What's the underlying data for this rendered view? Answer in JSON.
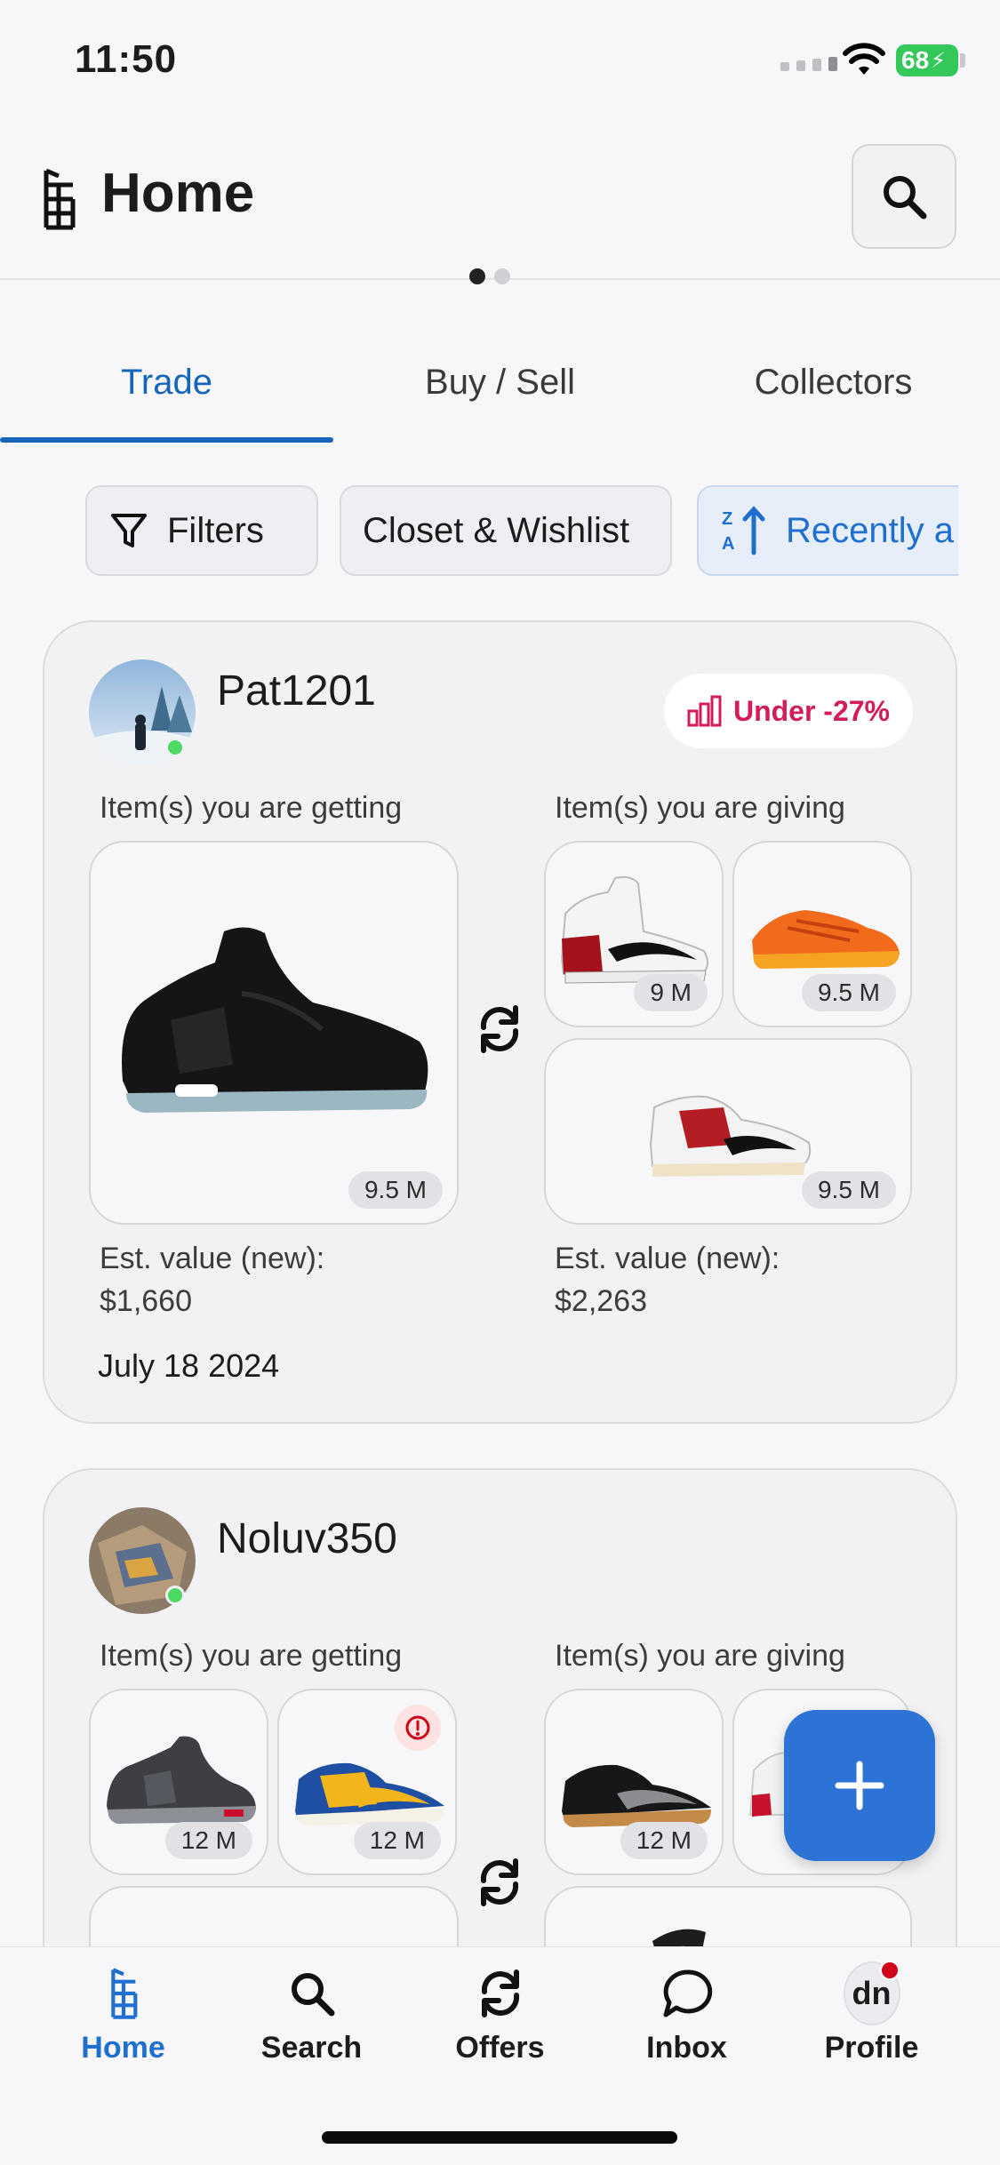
{
  "status_bar": {
    "time": "11:50",
    "battery": "68"
  },
  "header": {
    "title": "Home"
  },
  "tabs": [
    {
      "label": "Trade",
      "active": true
    },
    {
      "label": "Buy / Sell",
      "active": false
    },
    {
      "label": "Collectors",
      "active": false
    }
  ],
  "filters": {
    "filters_label": "Filters",
    "closet_label": "Closet & Wishlist",
    "sort_label": "Recently a"
  },
  "trades": [
    {
      "username": "Pat1201",
      "badge": "Under -27%",
      "getting_label": "Item(s) you are getting",
      "giving_label": "Item(s) you are giving",
      "getting_items": [
        {
          "name": "black-sneaker",
          "size": "9.5 M"
        }
      ],
      "giving_items": [
        {
          "name": "red-white-high-top",
          "size": "9 M"
        },
        {
          "name": "orange-runner",
          "size": "9.5 M"
        },
        {
          "name": "white-red-low",
          "size": "9.5 M"
        }
      ],
      "getting_value_label": "Est. value (new):",
      "getting_value": "$1,660",
      "giving_value_label": "Est. value (new):",
      "giving_value": "$2,263",
      "date": "July 18 2024"
    },
    {
      "username": "Noluv350",
      "getting_label": "Item(s) you are getting",
      "giving_label": "Item(s) you are giving",
      "getting_items": [
        {
          "name": "grey-red-sneaker",
          "size": "12 M"
        },
        {
          "name": "blue-yellow-dunk",
          "size": "12 M"
        }
      ],
      "giving_items": [
        {
          "name": "black-grey-dunk",
          "size": "12 M"
        }
      ]
    }
  ],
  "bottom_nav": [
    {
      "label": "Home",
      "active": true
    },
    {
      "label": "Search",
      "active": false
    },
    {
      "label": "Offers",
      "active": false
    },
    {
      "label": "Inbox",
      "active": false
    },
    {
      "label": "Profile",
      "active": false,
      "avatar_text": "dn"
    }
  ],
  "colors": {
    "accent": "#1565b8",
    "fab": "#2d73d6",
    "badge_red": "#d41c5a",
    "online": "#4cd964"
  }
}
